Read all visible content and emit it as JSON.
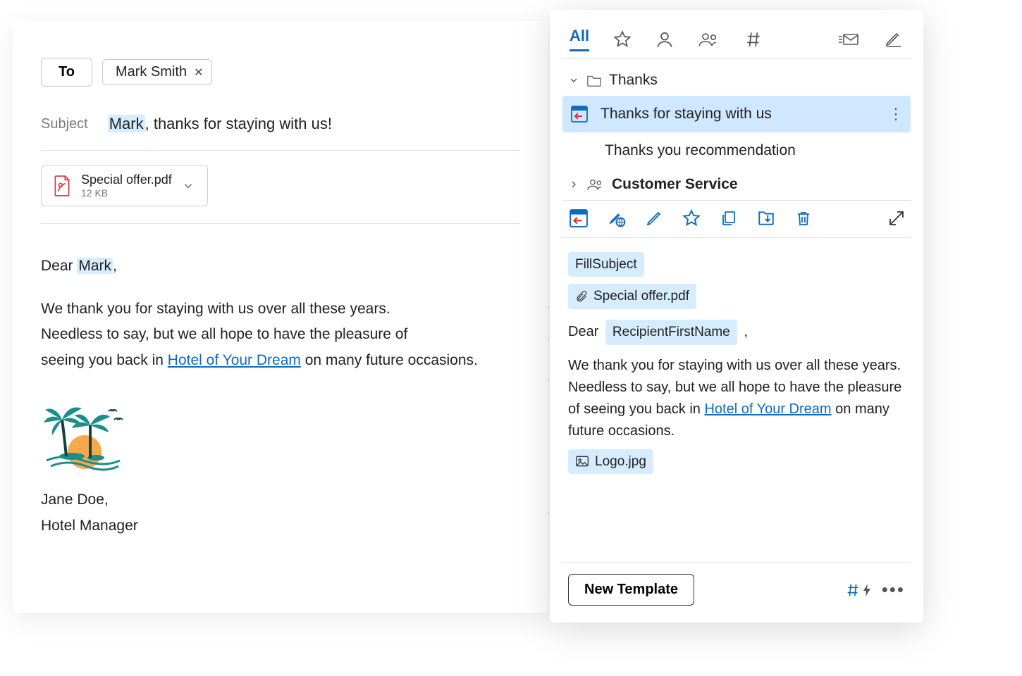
{
  "compose": {
    "to_label": "To",
    "recipient": "Mark Smith",
    "subject_label": "Subject",
    "subject_hl": "Mark",
    "subject_rest": ", thanks for staying with us!",
    "attachment": {
      "name": "Special offer.pdf",
      "size": "12 KB"
    },
    "greeting_prefix": "Dear ",
    "greeting_name": "Mark",
    "greeting_suffix": ",",
    "body_line1": "We thank you for staying with us over all these years.",
    "body_line2": "Needless to say, but we all hope to have the pleasure of",
    "body_line3a": "seeing you back in ",
    "body_link": "Hotel of Your Dream",
    "body_line3b": " on many future occasions.",
    "signature_name": "Jane Doe,",
    "signature_title": "Hotel Manager"
  },
  "side": {
    "tabs": {
      "all": "All"
    },
    "folder1": "Thanks",
    "template_selected": "Thanks for staying with us",
    "template2": "Thanks you recommendation",
    "folder2": "Customer Service",
    "preview": {
      "fill_subject": "FillSubject",
      "attachment": "Special offer.pdf",
      "dear": "Dear",
      "recipient_token": "RecipientFirstName",
      "comma": ",",
      "body_a": "We thank you for staying with us over all these years. Needless to say, but we all hope to have the pleasure of seeing you back in ",
      "body_link": "Hotel of Your Dream",
      "body_b": " on many future occasions.",
      "logo_tag": "Logo.jpg"
    },
    "new_template": "New Template"
  }
}
